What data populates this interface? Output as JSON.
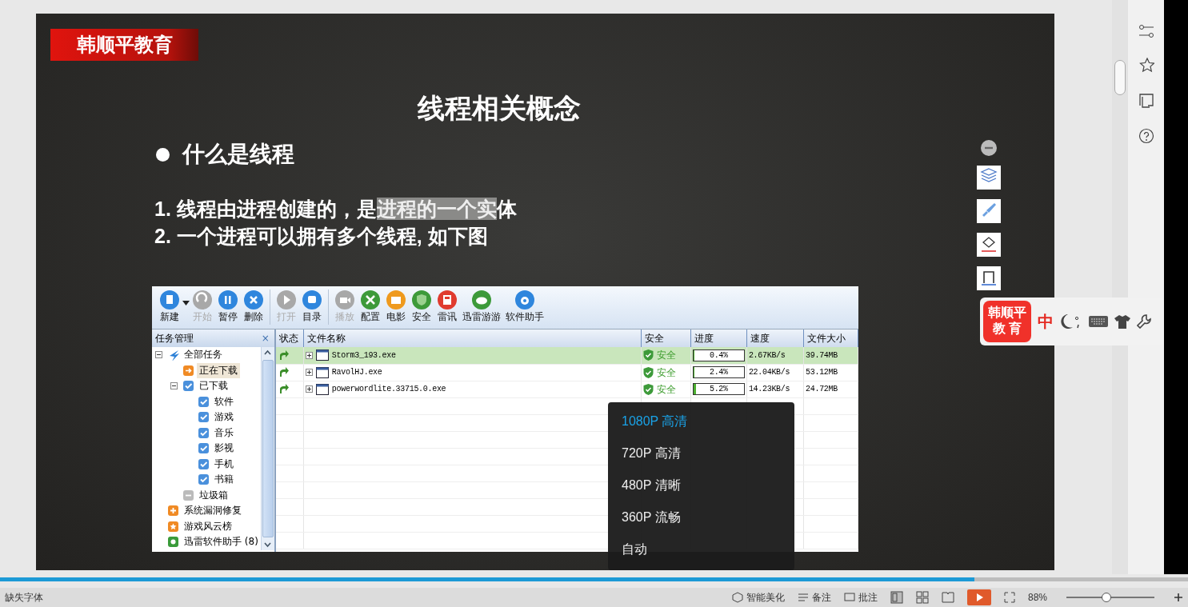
{
  "slide": {
    "logo": "韩顺平教育",
    "title": "线程相关概念",
    "bullet": "什么是线程",
    "points": [
      {
        "segments": [
          {
            "text": "1. 线程由进程创建的，是",
            "highlighted": false
          },
          {
            "text": "进程的一个实",
            "highlighted": true
          },
          {
            "text": "体",
            "highlighted": false
          }
        ]
      },
      {
        "segments": [
          {
            "text": "2. 一个进程可以拥有多个线程, 如下图",
            "highlighted": false
          }
        ]
      }
    ]
  },
  "app": {
    "toolbar": [
      {
        "label": "新建",
        "kind": "new",
        "color": "#2f86dd",
        "disabled": false,
        "dropdown": true
      },
      {
        "label": "开始",
        "kind": "start",
        "color": "#a8a8a8",
        "disabled": true,
        "dropdown": false
      },
      {
        "label": "暂停",
        "kind": "pause",
        "color": "#2f86dd",
        "disabled": false,
        "dropdown": false
      },
      {
        "label": "删除",
        "kind": "delete",
        "color": "#2f86dd",
        "disabled": false,
        "dropdown": false
      },
      {
        "label": "打开",
        "kind": "open",
        "color": "#a8a8a8",
        "disabled": true,
        "dropdown": false
      },
      {
        "label": "目录",
        "kind": "folder",
        "color": "#2f86dd",
        "disabled": false,
        "dropdown": false
      },
      {
        "label": "播放",
        "kind": "play",
        "color": "#a8a8a8",
        "disabled": true,
        "dropdown": false
      },
      {
        "label": "配置",
        "kind": "config",
        "color": "#3d9a3a",
        "disabled": false,
        "dropdown": false
      },
      {
        "label": "电影",
        "kind": "movie",
        "color": "#ef9a1e",
        "disabled": false,
        "dropdown": false
      },
      {
        "label": "安全",
        "kind": "security",
        "color": "#3d9a3a",
        "disabled": false,
        "dropdown": false
      },
      {
        "label": "雷讯",
        "kind": "news",
        "color": "#e03b2f",
        "disabled": false,
        "dropdown": false
      },
      {
        "label": "迅雷游游",
        "kind": "game",
        "color": "#3d9a3a",
        "disabled": false,
        "dropdown": false
      },
      {
        "label": "软件助手",
        "kind": "helper",
        "color": "#2f86dd",
        "disabled": false,
        "dropdown": false
      }
    ],
    "panel": {
      "title": "任务管理",
      "close": "×"
    },
    "tree": [
      {
        "label": "全部任务",
        "kind": "logo",
        "selected": false,
        "expanded": true,
        "children": [
          {
            "label": "正在下载",
            "kind": "download",
            "selected": true
          },
          {
            "label": "已下载",
            "kind": "check",
            "selected": false,
            "expanded": true,
            "children": [
              {
                "label": "软件",
                "kind": "check",
                "selected": false
              },
              {
                "label": "游戏",
                "kind": "check",
                "selected": false
              },
              {
                "label": "音乐",
                "kind": "check",
                "selected": false
              },
              {
                "label": "影视",
                "kind": "check",
                "selected": false
              },
              {
                "label": "手机",
                "kind": "check",
                "selected": false
              },
              {
                "label": "书籍",
                "kind": "check",
                "selected": false
              }
            ]
          },
          {
            "label": "垃圾箱",
            "kind": "trash",
            "selected": false
          }
        ]
      },
      {
        "label": "系统漏洞修复",
        "kind": "plus",
        "selected": false
      },
      {
        "label": "游戏风云榜",
        "kind": "star",
        "selected": false
      },
      {
        "label": "迅雷软件助手 (8)",
        "kind": "tool",
        "selected": false
      }
    ],
    "columns": [
      "状态",
      "文件名称",
      "安全",
      "进度",
      "速度",
      "文件大小"
    ],
    "rows": [
      {
        "name": "Storm3_193.exe",
        "safety": "安全",
        "progress": "0.4%",
        "level": 0.004,
        "speed": "2.67KB/s",
        "size": "39.74MB",
        "selected": true
      },
      {
        "name": "RavolHJ.exe",
        "safety": "安全",
        "progress": "2.4%",
        "level": 0.024,
        "speed": "22.04KB/s",
        "size": "53.12MB",
        "selected": false
      },
      {
        "name": "powerwordlite.33715.0.exe",
        "safety": "安全",
        "progress": "5.2%",
        "level": 0.052,
        "speed": "14.23KB/s",
        "size": "24.72MB",
        "selected": false
      }
    ]
  },
  "quality_menu": [
    {
      "label": "1080P 高清",
      "selected": true
    },
    {
      "label": "720P 高清",
      "selected": false
    },
    {
      "label": "480P 清晰",
      "selected": false
    },
    {
      "label": "360P 流畅",
      "selected": false
    },
    {
      "label": "自动",
      "selected": false
    }
  ],
  "ime_bar": {
    "logo_lines": [
      "韩顺平",
      "教 育"
    ],
    "mode": "中"
  },
  "video_progress": {
    "level": 0.82
  },
  "status_bar": {
    "missing_fonts": "缺失字体",
    "beautify": "智能美化",
    "notes": "备注",
    "comments": "批注",
    "zoom": "88%",
    "zoom_slider": {
      "level": 0.45
    }
  }
}
